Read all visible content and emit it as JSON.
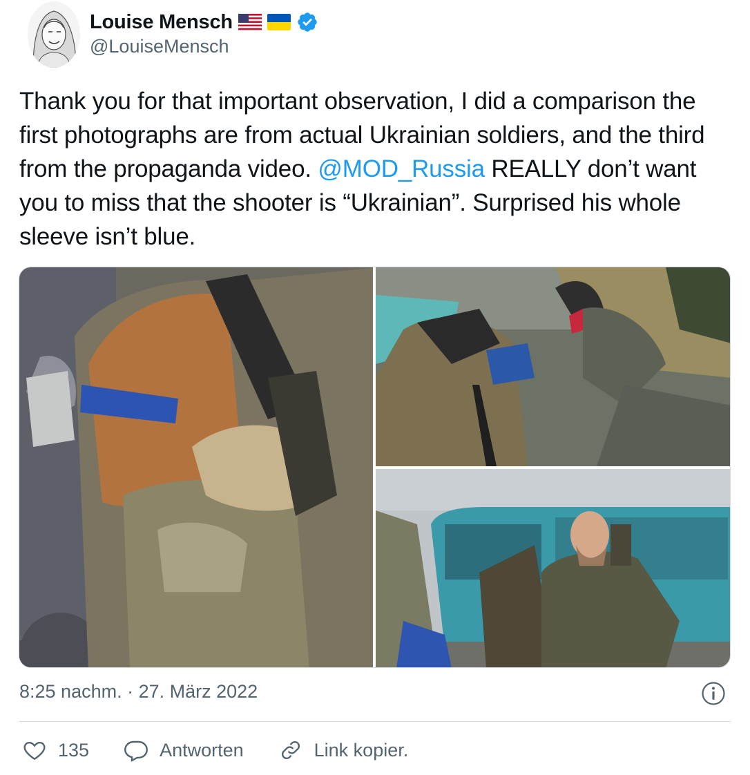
{
  "author": {
    "display_name": "Louise Mensch",
    "handle": "@LouiseMensch",
    "badges": [
      "us-flag-icon",
      "ukraine-flag-icon",
      "verified-badge-icon"
    ]
  },
  "tweet": {
    "text_before_mention": "Thank you for that important observation, I did a comparison the first photographs are from actual Ukrainian soldiers, and the third from the propaganda video.",
    "mention": "@MOD_Russia",
    "text_after_mention": " REALLY don’t want you to miss that the shooter is “Ukrainian”. Surprised his whole sleeve isn’t blue."
  },
  "media": {
    "photos": [
      "soldier-blue-armband-photo",
      "soldiers-in-trench-photo",
      "man-by-blue-van-photo"
    ]
  },
  "meta": {
    "timestamp": "8:25 nachm. · 27. März 2022"
  },
  "actions": {
    "like_count": "135",
    "reply_label": "Antworten",
    "copy_link_label": "Link kopier."
  },
  "colors": {
    "link": "#1d9bf0",
    "secondary_text": "#536471",
    "border": "#cfd9de",
    "verified": "#1d9bf0"
  }
}
